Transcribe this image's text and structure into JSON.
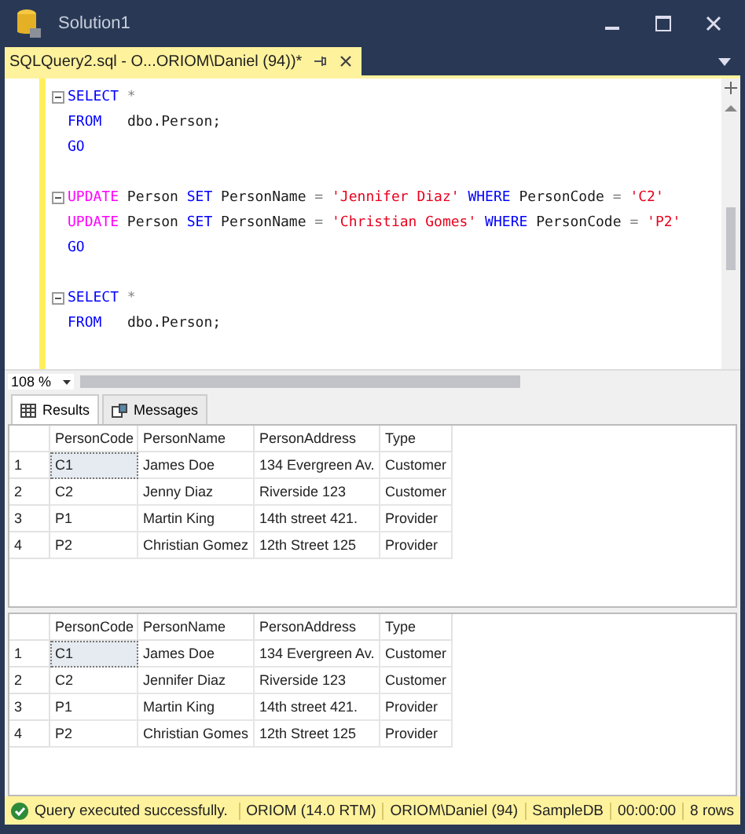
{
  "window": {
    "title": "Solution1"
  },
  "document_tab": {
    "title": "SQLQuery2.sql - O...ORIOM\\Daniel (94))*",
    "selected": true
  },
  "editor": {
    "blocks": [
      {
        "lines": [
          {
            "fold": true,
            "tokens": [
              {
                "text": "SELECT",
                "kind": "keyword"
              },
              {
                "text": " *",
                "kind": "operator"
              }
            ]
          },
          {
            "fold": false,
            "tokens": [
              {
                "text": "FROM",
                "kind": "keyword"
              },
              {
                "text": "   dbo.Person;",
                "kind": "plain"
              }
            ]
          },
          {
            "fold": false,
            "tokens": [
              {
                "text": "GO",
                "kind": "keyword"
              }
            ]
          }
        ]
      },
      {
        "lines": [
          {
            "fold": true,
            "tokens": [
              {
                "text": "UPDATE",
                "kind": "function"
              },
              {
                "text": " Person ",
                "kind": "plain"
              },
              {
                "text": "SET",
                "kind": "keyword"
              },
              {
                "text": " PersonName ",
                "kind": "plain"
              },
              {
                "text": "= ",
                "kind": "operator"
              },
              {
                "text": "'Jennifer Diaz'",
                "kind": "string"
              },
              {
                "text": " WHERE",
                "kind": "keyword"
              },
              {
                "text": " PersonCode ",
                "kind": "plain"
              },
              {
                "text": "= ",
                "kind": "operator"
              },
              {
                "text": "'C2'",
                "kind": "string"
              }
            ]
          },
          {
            "fold": false,
            "tokens": [
              {
                "text": "UPDATE",
                "kind": "function"
              },
              {
                "text": " Person ",
                "kind": "plain"
              },
              {
                "text": "SET",
                "kind": "keyword"
              },
              {
                "text": " PersonName ",
                "kind": "plain"
              },
              {
                "text": "= ",
                "kind": "operator"
              },
              {
                "text": "'Christian Gomes'",
                "kind": "string"
              },
              {
                "text": " WHERE",
                "kind": "keyword"
              },
              {
                "text": " PersonCode ",
                "kind": "plain"
              },
              {
                "text": "= ",
                "kind": "operator"
              },
              {
                "text": "'P2'",
                "kind": "string"
              }
            ]
          },
          {
            "fold": false,
            "tokens": [
              {
                "text": "GO",
                "kind": "keyword"
              }
            ]
          }
        ]
      },
      {
        "lines": [
          {
            "fold": true,
            "tokens": [
              {
                "text": "SELECT",
                "kind": "keyword"
              },
              {
                "text": " *",
                "kind": "operator"
              }
            ]
          },
          {
            "fold": false,
            "tokens": [
              {
                "text": "FROM",
                "kind": "keyword"
              },
              {
                "text": "   dbo.Person;",
                "kind": "plain"
              }
            ]
          }
        ]
      }
    ]
  },
  "zoom": {
    "value": "108 %"
  },
  "result_tabs": [
    {
      "label": "Results",
      "selected": true
    },
    {
      "label": "Messages",
      "selected": false
    }
  ],
  "grids": [
    {
      "columns": [
        "PersonCode",
        "PersonName",
        "PersonAddress",
        "Type"
      ],
      "rows": [
        {
          "number": "1",
          "cells": [
            {
              "text": "C1",
              "selected": true
            },
            {
              "text": "James Doe",
              "selected": false
            },
            {
              "text": "134 Evergreen Av.",
              "selected": false
            },
            {
              "text": "Customer",
              "selected": false
            }
          ]
        },
        {
          "number": "2",
          "cells": [
            {
              "text": "C2",
              "selected": false
            },
            {
              "text": "Jenny Diaz",
              "selected": false
            },
            {
              "text": "Riverside 123",
              "selected": false
            },
            {
              "text": "Customer",
              "selected": false
            }
          ]
        },
        {
          "number": "3",
          "cells": [
            {
              "text": "P1",
              "selected": false
            },
            {
              "text": "Martin King",
              "selected": false
            },
            {
              "text": "14th street 421.",
              "selected": false
            },
            {
              "text": "Provider",
              "selected": false
            }
          ]
        },
        {
          "number": "4",
          "cells": [
            {
              "text": "P2",
              "selected": false
            },
            {
              "text": "Christian Gomez",
              "selected": false
            },
            {
              "text": "12th Street 125",
              "selected": false
            },
            {
              "text": "Provider",
              "selected": false
            }
          ]
        }
      ]
    },
    {
      "columns": [
        "PersonCode",
        "PersonName",
        "PersonAddress",
        "Type"
      ],
      "rows": [
        {
          "number": "1",
          "cells": [
            {
              "text": "C1",
              "selected": true
            },
            {
              "text": "James Doe",
              "selected": false
            },
            {
              "text": "134 Evergreen Av.",
              "selected": false
            },
            {
              "text": "Customer",
              "selected": false
            }
          ]
        },
        {
          "number": "2",
          "cells": [
            {
              "text": "C2",
              "selected": false
            },
            {
              "text": "Jennifer Diaz",
              "selected": false
            },
            {
              "text": "Riverside 123",
              "selected": false
            },
            {
              "text": "Customer",
              "selected": false
            }
          ]
        },
        {
          "number": "3",
          "cells": [
            {
              "text": "P1",
              "selected": false
            },
            {
              "text": "Martin King",
              "selected": false
            },
            {
              "text": "14th street 421.",
              "selected": false
            },
            {
              "text": "Provider",
              "selected": false
            }
          ]
        },
        {
          "number": "4",
          "cells": [
            {
              "text": "P2",
              "selected": false
            },
            {
              "text": "Christian Gomes",
              "selected": false
            },
            {
              "text": "12th Street 125",
              "selected": false
            },
            {
              "text": "Provider",
              "selected": false
            }
          ]
        }
      ]
    }
  ],
  "status_bar": {
    "message": "Query executed successfully.",
    "fields": [
      "ORIOM (14.0 RTM)",
      "ORIOM\\Daniel (94)",
      "SampleDB",
      "00:00:00",
      "8 rows"
    ]
  }
}
